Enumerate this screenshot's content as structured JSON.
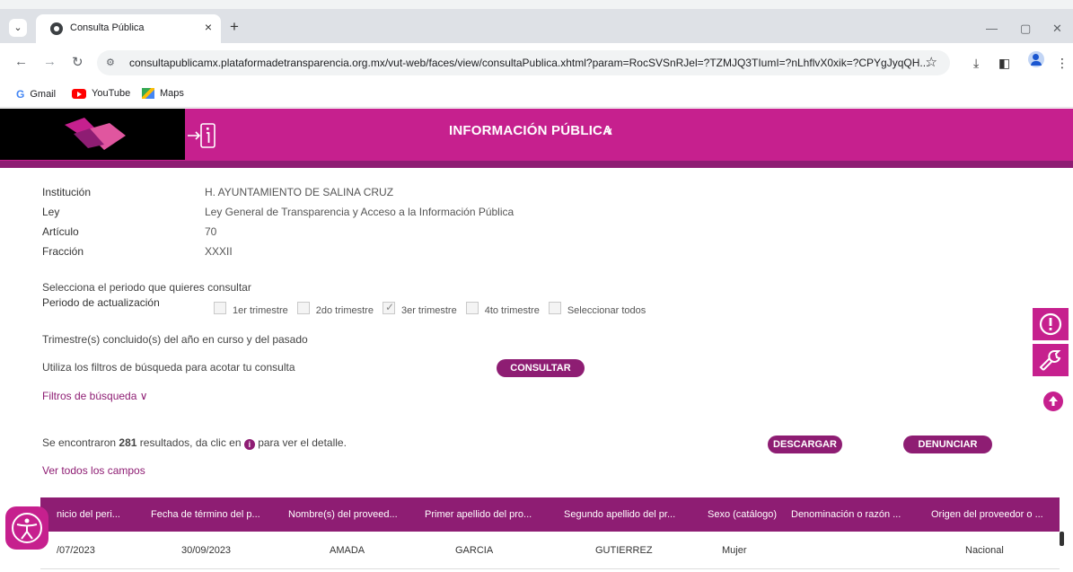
{
  "browser": {
    "tab_title": "Consulta Pública",
    "tab_close": "×",
    "new_tab": "+",
    "url": "consultapublicamx.plataformadetransparencia.org.mx/vut-web/faces/view/consultaPublica.xhtml?param=RocSVSnRJel=?TZMJQ3TIumI=?nLhflvX0xik=?CPYgJyqQH...",
    "bookmarks": [
      "Gmail",
      "YouTube",
      "Maps"
    ]
  },
  "header": {
    "title": "INFORMACIÓN PÚBLICA",
    "chevron": "∨"
  },
  "details": [
    {
      "label": "Institución",
      "value": "H. AYUNTAMIENTO DE SALINA CRUZ"
    },
    {
      "label": "Ley",
      "value": "Ley General de Transparencia y Acceso a la Información Pública"
    },
    {
      "label": "Artículo",
      "value": "70"
    },
    {
      "label": "Fracción",
      "value": "XXXII"
    }
  ],
  "period": {
    "prompt": "Selecciona el periodo que quieres consultar",
    "label": "Periodo de actualización",
    "options": [
      {
        "label": "1er trimestre",
        "checked": false
      },
      {
        "label": "2do trimestre",
        "checked": false
      },
      {
        "label": "3er trimestre",
        "checked": true
      },
      {
        "label": "4to trimestre",
        "checked": false
      },
      {
        "label": "Seleccionar todos",
        "checked": false
      }
    ],
    "note": "Trimestre(s) concluido(s) del año en curso y del pasado"
  },
  "filters": {
    "hint": "Utiliza los filtros de búsqueda para acotar tu consulta",
    "consult_button": "CONSULTAR",
    "toggle_label": "Filtros de búsqueda"
  },
  "results": {
    "prefix": "Se encontraron",
    "count": "281",
    "suffix_a": "resultados, da clic en",
    "suffix_b": "para ver el detalle.",
    "download_button": "DESCARGAR",
    "report_button": "DENUNCIAR",
    "all_fields_link": "Ver todos los campos"
  },
  "table": {
    "headers": [
      "nicio del peri...",
      "Fecha de término del p...",
      "Nombre(s) del proveed...",
      "Primer apellido del pro...",
      "Segundo apellido del pr...",
      "Sexo (catálogo)",
      "Denominación o razón ...",
      "Origen del proveedor o ..."
    ],
    "rows": [
      [
        "/07/2023",
        "30/09/2023",
        "AMADA",
        "GARCIA",
        "GUTIERREZ",
        "Mujer",
        "",
        "Nacional"
      ]
    ]
  },
  "icons": {
    "side": [
      "alert-icon",
      "wrench-icon",
      "scroll-up-icon"
    ],
    "accessibility": "accessibility-icon"
  },
  "colors": {
    "brand_magenta": "#c6208e",
    "brand_purple": "#8e1d73"
  }
}
